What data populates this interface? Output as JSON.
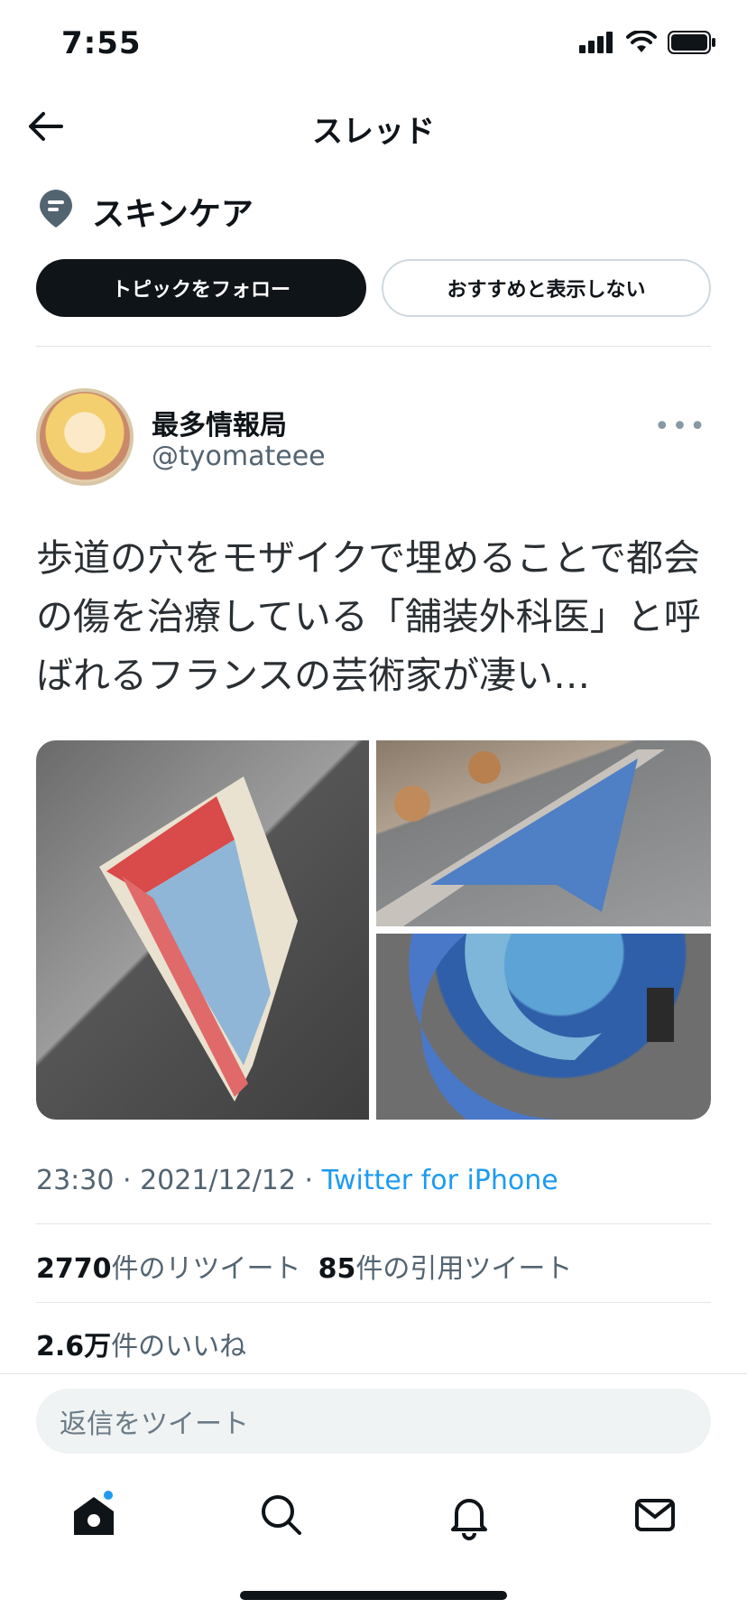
{
  "status": {
    "time": "7:55"
  },
  "header": {
    "title": "スレッド"
  },
  "topic": {
    "name": "スキンケア",
    "follow_label": "トピックをフォロー",
    "hide_label": "おすすめと表示しない"
  },
  "tweet": {
    "author_name": "最多情報局",
    "author_handle": "@tyomateee",
    "text": "歩道の穴をモザイクで埋めることで都会の傷を治療している「舗装外科医」と呼ばれるフランスの芸術家が凄い…",
    "timestamp": "23:30 · 2021/12/12 · ",
    "source": "Twitter for iPhone",
    "retweets": "2770",
    "retweets_label": "件のリツイート",
    "quotes": "85",
    "quotes_label": "件の引用ツイート",
    "likes": "2.6万",
    "likes_label": "件のいいね"
  },
  "reply": {
    "placeholder": "返信をツイート"
  },
  "tabs": [
    {
      "icon": "home-icon"
    },
    {
      "icon": "search-icon"
    },
    {
      "icon": "bell-icon"
    },
    {
      "icon": "mail-icon"
    }
  ],
  "colors": {
    "accent": "#1d9bf0",
    "text": "#0f1419",
    "muted": "#536471"
  }
}
